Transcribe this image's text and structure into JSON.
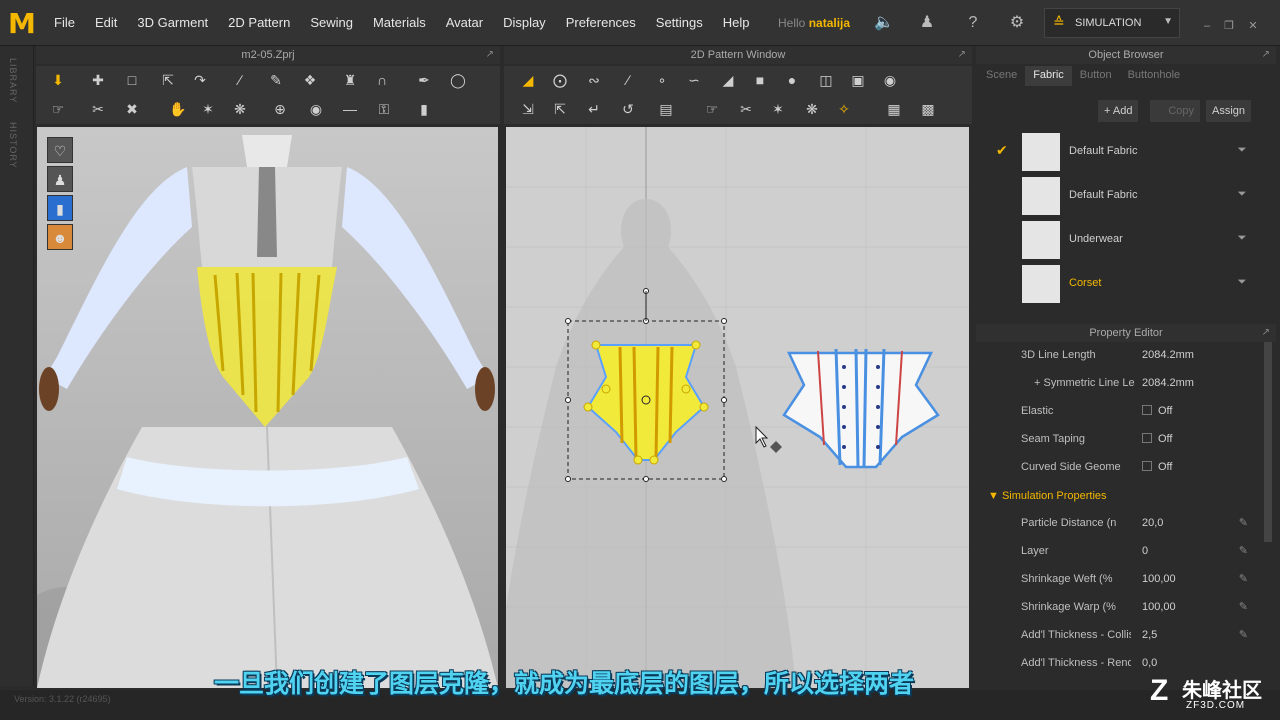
{
  "menu": [
    "File",
    "Edit",
    "3D Garment",
    "2D Pattern",
    "Sewing",
    "Materials",
    "Avatar",
    "Display",
    "Preferences",
    "Settings",
    "Help"
  ],
  "greeting": {
    "hello": "Hello",
    "user": "natalija"
  },
  "simulation_label": "SIMULATION",
  "side_tabs": [
    "LIBRARY",
    "HISTORY"
  ],
  "panels": {
    "view3d_title": "m2-05.Zprj",
    "view2d_title": "2D Pattern Window",
    "object_browser_title": "Object Browser",
    "property_editor_title": "Property Editor"
  },
  "object_browser": {
    "tabs": [
      "Scene",
      "Fabric",
      "Button",
      "Buttonhole"
    ],
    "active_tab": "Fabric",
    "actions": {
      "add": "+ Add",
      "copy": "Copy",
      "assign": "Assign"
    },
    "fabrics": [
      {
        "name": "Default Fabric",
        "checked": true,
        "selected": false
      },
      {
        "name": "Default Fabric",
        "checked": false,
        "selected": false
      },
      {
        "name": "Underwear",
        "checked": false,
        "selected": false
      },
      {
        "name": "Corset",
        "checked": false,
        "selected": true
      }
    ]
  },
  "property_editor": {
    "rows": [
      {
        "label": "3D Line Length",
        "value": "2084.2mm",
        "indent": false
      },
      {
        "label": "+ Symmetric Line Le",
        "value": "2084.2mm",
        "indent": true
      },
      {
        "label": "Elastic",
        "value": "Off",
        "check": true
      },
      {
        "label": "Seam Taping",
        "value": "Off",
        "check": true
      },
      {
        "label": "Curved Side Geome",
        "value": "Off",
        "check": true
      }
    ],
    "section": "Simulation Properties",
    "sim_rows": [
      {
        "label": "Particle Distance (n",
        "value": "20,0"
      },
      {
        "label": "Layer",
        "value": "0"
      },
      {
        "label": "Shrinkage Weft (%",
        "value": "100,00"
      },
      {
        "label": "Shrinkage Warp (%",
        "value": "100,00"
      },
      {
        "label": "Add'l Thickness - Collisic",
        "value": "2,5"
      },
      {
        "label": "Add'l Thickness - Render",
        "value": "0,0"
      }
    ]
  },
  "status": {
    "version": "Version: 3.1.22   (r24695)"
  },
  "subtitle": "一旦我们创建了图层克隆，就成为最底层的图层，所以选择两者",
  "watermark": {
    "text": "朱峰社区",
    "url": "ZF3D.COM"
  },
  "colors": {
    "accent": "#f5b800",
    "corset": "#f2ea3a",
    "subtitle": "#4fd3f0"
  }
}
